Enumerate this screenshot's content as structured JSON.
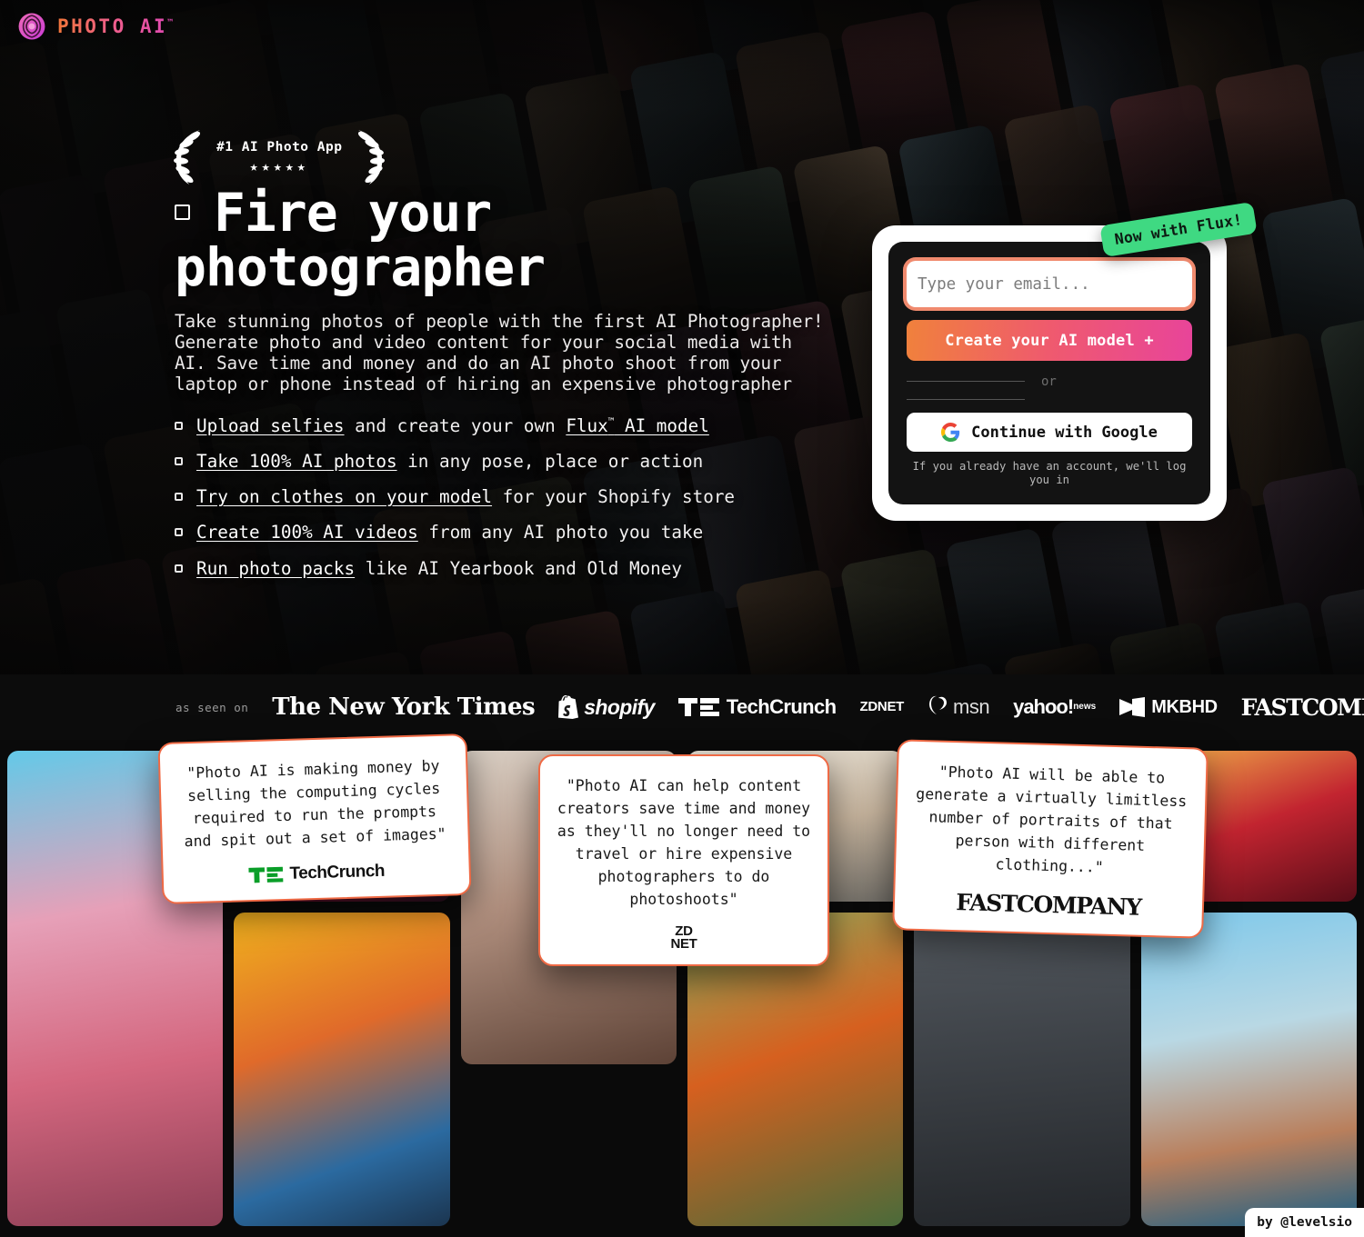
{
  "brand": {
    "name": "PHOTO AI",
    "trademark": "™",
    "logo_icon": "aperture-spiral-icon",
    "gradient_from": "#f2763a",
    "gradient_to": "#e048b4"
  },
  "badge": {
    "title": "#1 AI Photo App",
    "stars": "★★★★★",
    "star_count": 5,
    "left_icon": "laurel-left-icon",
    "right_icon": "laurel-right-icon"
  },
  "hero": {
    "headline": "Fire your photographer",
    "subcopy": "Take stunning photos of people with the first AI Photographer! Generate photo and video content for your social media with AI. Save time and money and do an AI photo shoot from your laptop or phone instead of hiring an expensive photographer",
    "features": [
      {
        "link": "Upload selfies",
        "rest": " and create your own ",
        "link2": "Flux",
        "sup": "™",
        "rest2": " AI model"
      },
      {
        "link": "Take 100% AI photos",
        "rest": " in any pose, place or action"
      },
      {
        "link": "Try on clothes on your model",
        "rest": " for your Shopify store"
      },
      {
        "link": "Create 100% AI videos",
        "rest": " from any AI photo you take"
      },
      {
        "link": "Run photo packs",
        "rest": " like AI Yearbook and Old Money"
      }
    ]
  },
  "signup": {
    "ribbon": "Now with Flux!",
    "ribbon_color": "#3fd982",
    "email_placeholder": "Type your email...",
    "email_value": "",
    "cta_label": "Create your AI model +",
    "cta_gradient_from": "#f0813c",
    "cta_gradient_to": "#e8449a",
    "divider_label": "or",
    "google_label": "Continue with Google",
    "google_icon": "google-g-icon",
    "login_note": "If you already have an account, we'll log you in"
  },
  "press": {
    "label": "as seen on",
    "logos": [
      {
        "name": "The New York Times",
        "style": "nyt"
      },
      {
        "name": "shopify",
        "style": "shopify",
        "icon": "shopify-bag-icon"
      },
      {
        "name": "TechCrunch",
        "style": "techcrunch",
        "icon": "techcrunch-mark-icon"
      },
      {
        "name": "ZD NET",
        "line1": "ZD",
        "line2": "NET",
        "style": "zdnet"
      },
      {
        "name": "msn",
        "style": "msn",
        "icon": "msn-butterfly-icon"
      },
      {
        "name": "yahoo news",
        "line1": "yahoo!",
        "line2": "news",
        "style": "yahoo"
      },
      {
        "name": "MKBHD",
        "style": "mkbhd",
        "icon": "mkbhd-bowtie-icon"
      },
      {
        "name": "FASTCOMPANY",
        "style": "fastco"
      }
    ]
  },
  "quotes": [
    {
      "text": "\"Photo AI is making money by selling the computing cycles required to run the prompts and spit out a set of images\"",
      "source": "TechCrunch",
      "source_style": "techcrunch"
    },
    {
      "text": "\"Photo AI can help content creators save time and money as they'll no longer need to travel or hire expensive photographers to do photoshoots\"",
      "source": "ZDNET",
      "source_style": "zdnet"
    },
    {
      "text": "\"Photo AI will be able to generate a virtually limitless number of portraits of that person with different clothing...\"",
      "source": "FASTCOMPANY",
      "source_style": "fastco"
    }
  ],
  "footer": {
    "credit": "by @levelsio"
  },
  "gallery": {
    "items": [
      "man-in-pink-suit-palm-trees",
      "dj-mixing-deck-neon",
      "woman-with-choker-portrait",
      "woman-beige-sweater-jeans",
      "man-black-hat-jacket-street",
      "candlelit-dinner-red-roses",
      "colorful-painted-woman-headwrap",
      "blonde-woman-orange-dress-outdoors",
      "shirtless-man-beach-sea"
    ]
  }
}
